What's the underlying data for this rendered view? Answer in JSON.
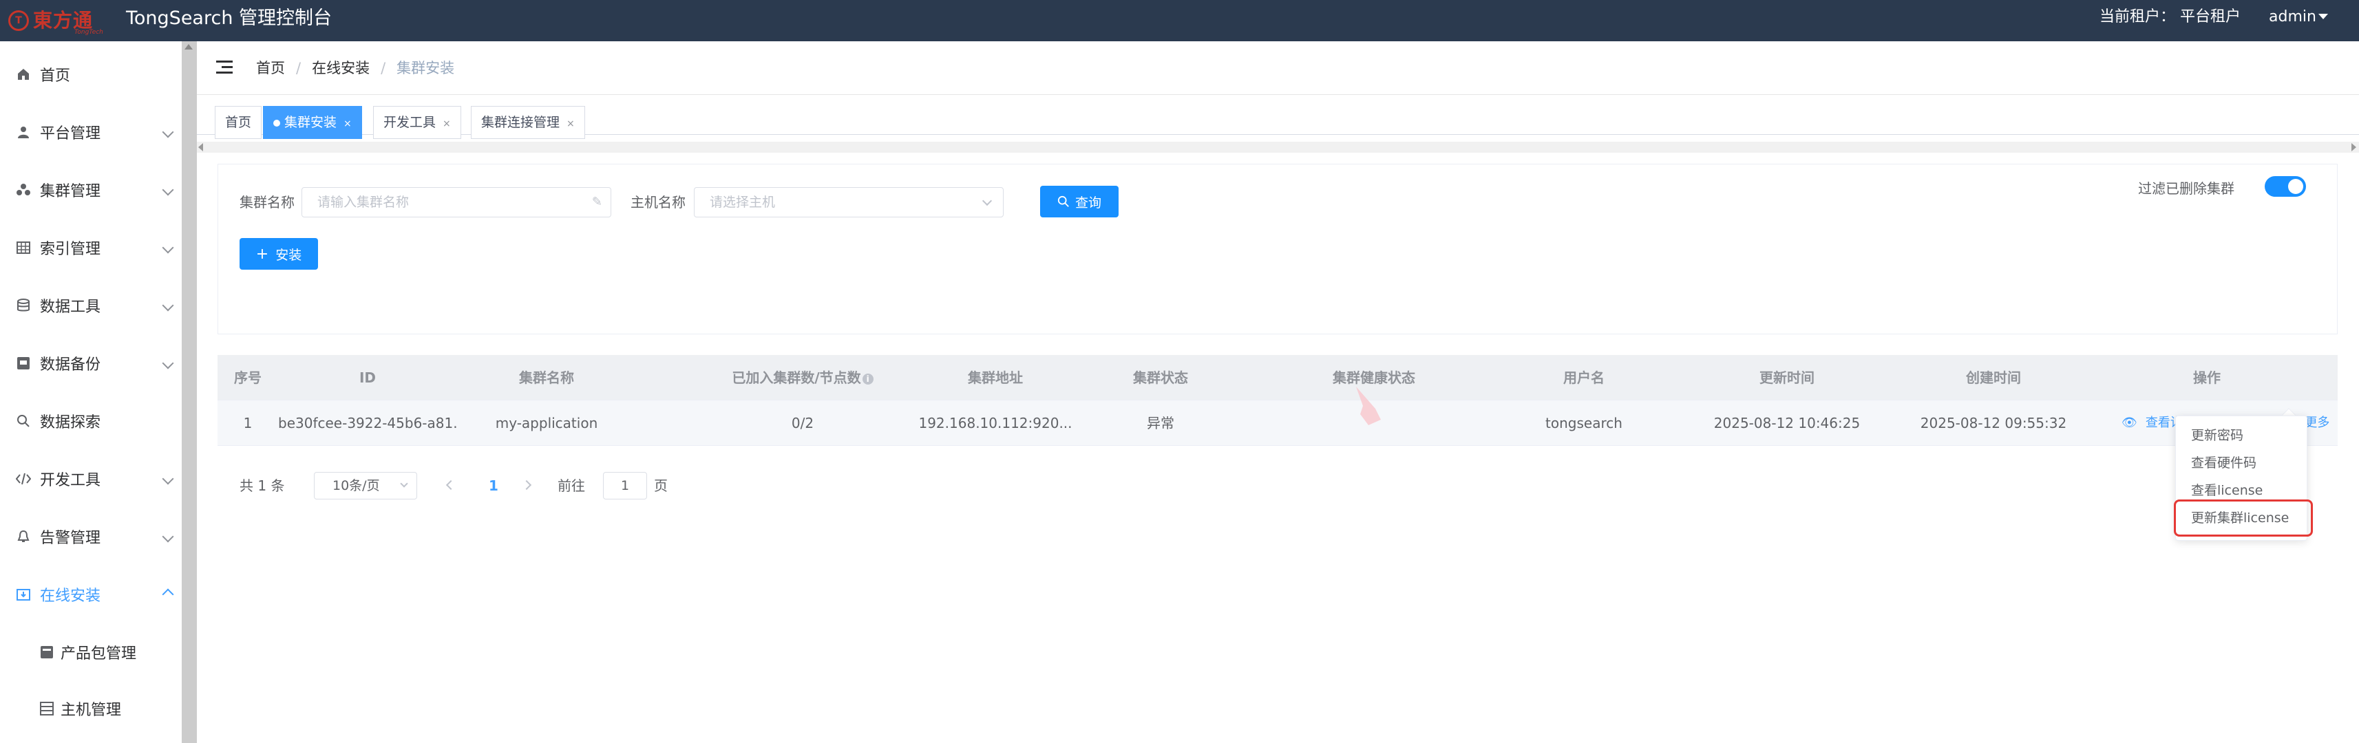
{
  "header": {
    "logo_text": "東方通",
    "logo_sub": "TongTech",
    "app_title": "TongSearch 管理控制台",
    "tenant_text": "当前租户：  平台租户",
    "user": "admin"
  },
  "sidebar": {
    "items": [
      {
        "label": "首页",
        "icon": "home-icon"
      },
      {
        "label": "平台管理",
        "icon": "user-icon"
      },
      {
        "label": "集群管理",
        "icon": "cluster-icon"
      },
      {
        "label": "索引管理",
        "icon": "table-icon"
      },
      {
        "label": "数据工具",
        "icon": "database-icon"
      },
      {
        "label": "数据备份",
        "icon": "backup-icon"
      },
      {
        "label": "数据探索",
        "icon": "search-icon"
      },
      {
        "label": "开发工具",
        "icon": "code-icon"
      },
      {
        "label": "告警管理",
        "icon": "bell-icon"
      },
      {
        "label": "在线安装",
        "icon": "install-icon"
      },
      {
        "label": "产品包管理",
        "icon": "package-icon"
      },
      {
        "label": "主机管理",
        "icon": "host-icon"
      }
    ]
  },
  "breadcrumb": {
    "home": "首页",
    "parent": "在线安装",
    "current": "集群安装"
  },
  "tabs": [
    {
      "label": "首页"
    },
    {
      "label": "集群安装"
    },
    {
      "label": "开发工具"
    },
    {
      "label": "集群连接管理"
    }
  ],
  "search": {
    "cluster_label": "集群名称",
    "cluster_placeholder": "请输入集群名称",
    "host_label": "主机名称",
    "host_placeholder": "请选择主机",
    "query_button": "查询",
    "install_button": "安装",
    "filter_label": "过滤已删除集群"
  },
  "table": {
    "headers": [
      "序号",
      "ID",
      "集群名称",
      "已加入集群数/节点数",
      "集群地址",
      "集群状态",
      "集群健康状态",
      "用户名",
      "更新时间",
      "创建时间",
      "操作"
    ],
    "rows": [
      [
        "1",
        "be30fcee-3922-45b6-a81...",
        "my-application",
        "0/2",
        "192.168.10.112:920...",
        "异常",
        "",
        "tongsearch",
        "2025-08-12 10:46:25",
        "2025-08-12 09:55:32"
      ]
    ],
    "ops": {
      "view": "查看详情",
      "delete": "删除",
      "more": "更多"
    }
  },
  "pager": {
    "total": "共 1 条",
    "page_size": "10条/页",
    "current": "1",
    "goto_label": "前往",
    "goto_value": "1",
    "page_unit": "页"
  },
  "dropdown": [
    "更新密码",
    "查看硬件码",
    "查看license",
    "更新集群license"
  ]
}
